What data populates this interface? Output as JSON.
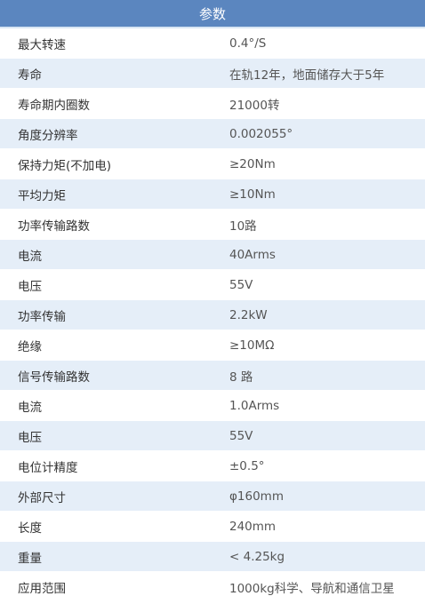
{
  "header": {
    "title": "参数"
  },
  "rows": [
    {
      "label": "最大转速",
      "value": "0.4°/S"
    },
    {
      "label": "寿命",
      "value": "在轨12年，地面储存大于5年"
    },
    {
      "label": "寿命期内圈数",
      "value": "21000转"
    },
    {
      "label": "角度分辨率",
      "value": "0.002055°"
    },
    {
      "label": "保持力矩(不加电)",
      "value": "≥20Nm"
    },
    {
      "label": "平均力矩",
      "value": "≥10Nm"
    },
    {
      "label": "功率传输路数",
      "value": "10路"
    },
    {
      "label": "电流",
      "value": "40Arms"
    },
    {
      "label": "电压",
      "value": "55V"
    },
    {
      "label": "功率传输",
      "value": "2.2kW"
    },
    {
      "label": "绝缘",
      "value": "≥10MΩ"
    },
    {
      "label": "信号传输路数",
      "value": "8 路"
    },
    {
      "label": "电流",
      "value": "1.0Arms"
    },
    {
      "label": "电压",
      "value": "55V"
    },
    {
      "label": "电位计精度",
      "value": "±0.5°"
    },
    {
      "label": "外部尺寸",
      "value": "φ160mm"
    },
    {
      "label": "长度",
      "value": "240mm"
    },
    {
      "label": "重量",
      "value": "< 4.25kg"
    },
    {
      "label": "应用范围",
      "value": "1000kg科学、导航和通信卫星"
    }
  ]
}
